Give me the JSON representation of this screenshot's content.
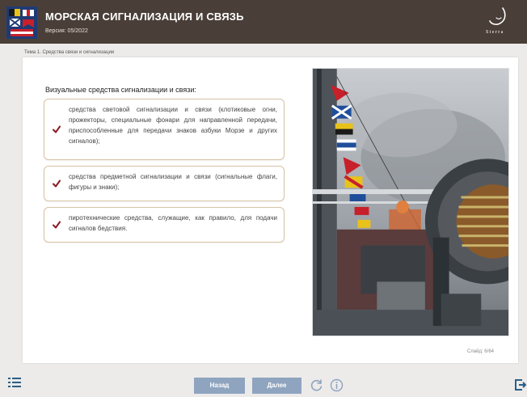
{
  "header": {
    "title": "МОРСКАЯ СИГНАЛИЗАЦИЯ И СВЯЗЬ",
    "version": "Версия: 05/2022",
    "brand_text": "Sterra"
  },
  "breadcrumb": "Тема 1. Средства связи и сигнализации",
  "content": {
    "heading": "Визуальные средства сигнализации и связи:",
    "items": [
      {
        "text": "средства световой сигнализации и связи (клотиковые огни, прожекторы, специальные фонари для направленной передачи, приспособленные для передачи знаков азбуки Морзе и других сигналов);"
      },
      {
        "text": "средства предметной сигнализации и связи (сигнальные флаги, фигуры и знаки);"
      },
      {
        "text": "пиротехнические средства, служащие, как правило, для подачи сигналов бедствия."
      }
    ]
  },
  "slide_counter": "Слайд: 6/64",
  "footer": {
    "back_label": "Назад",
    "next_label": "Далее"
  },
  "colors": {
    "header_bg": "#4a3f38",
    "accent": "#8b1a24",
    "button": "#8fa4bf",
    "icon": "#2c5f86"
  },
  "icons": [
    "logo-flags-icon",
    "brand-logo-icon",
    "check-icon",
    "menu-icon",
    "reload-icon",
    "info-icon",
    "exit-icon"
  ]
}
